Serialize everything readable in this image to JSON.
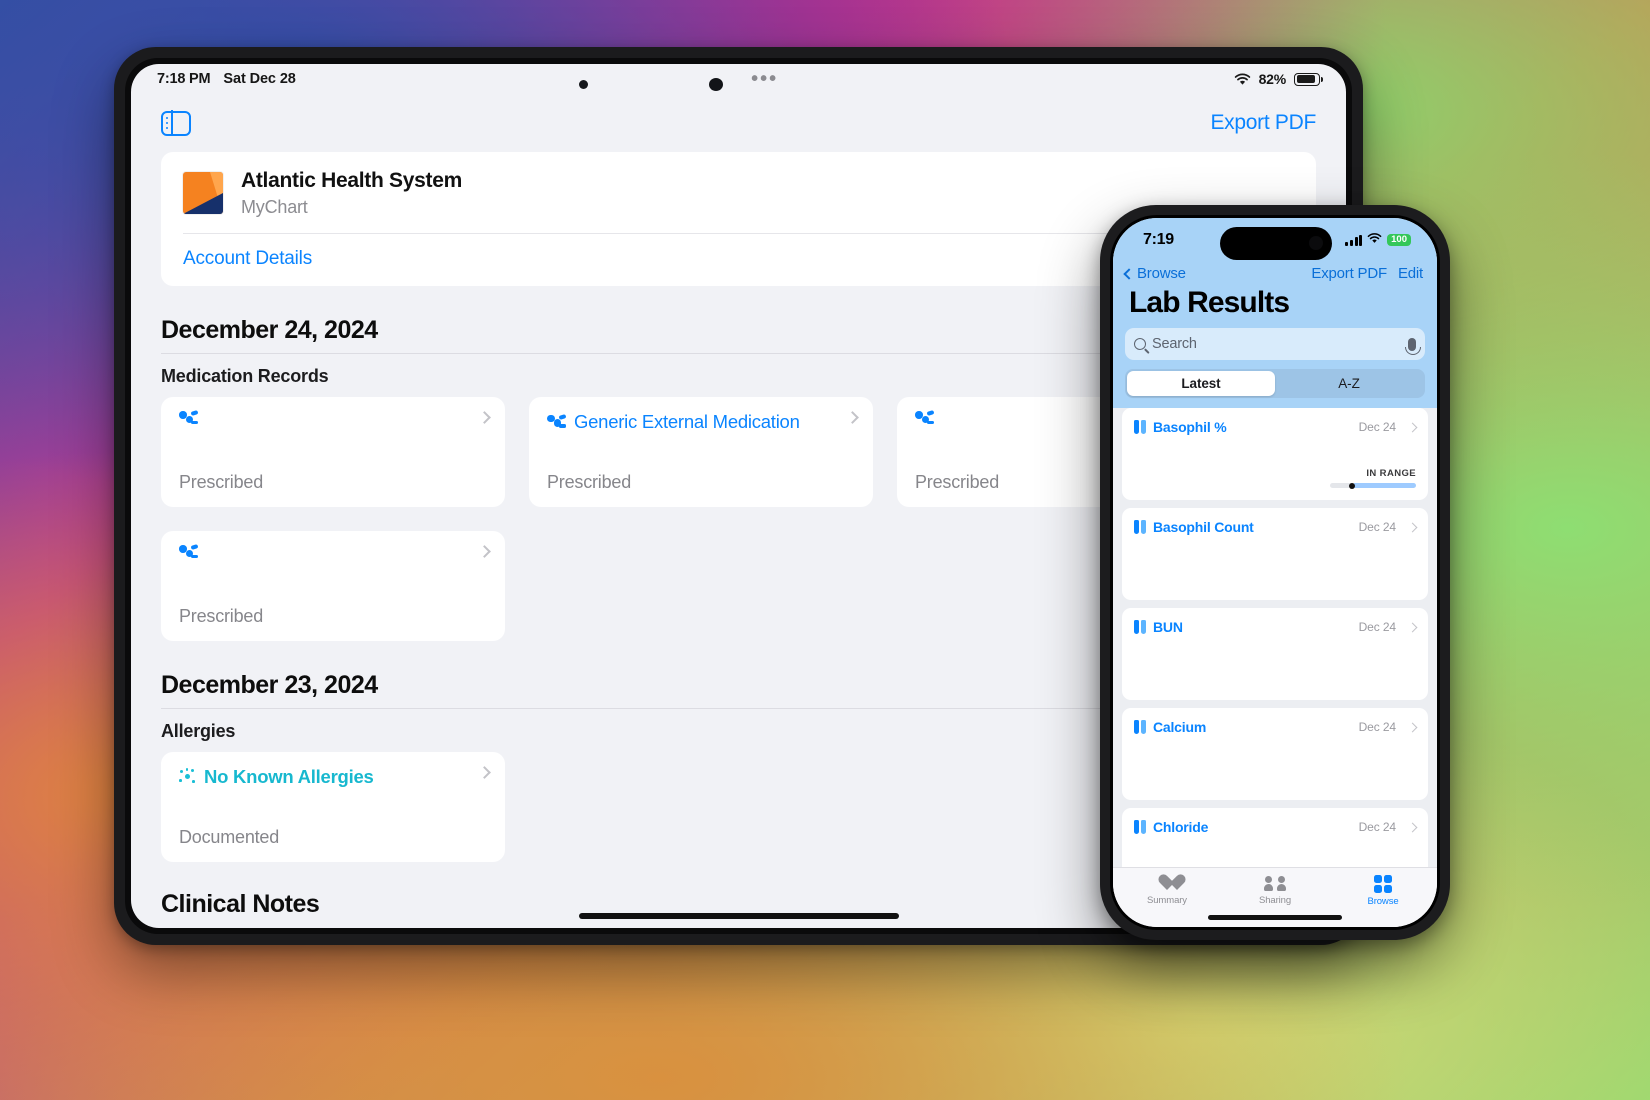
{
  "ipad": {
    "status": {
      "time": "7:18 PM",
      "date": "Sat Dec 28",
      "battery_pct": "82%"
    },
    "nav": {
      "sidebar_icon": "sidebar-toggle-icon",
      "export_pdf": "Export PDF"
    },
    "org": {
      "logo": "mychart-logo",
      "name": "Atlantic Health System",
      "subtitle": "MyChart",
      "account_details": "Account Details"
    },
    "sections": [
      {
        "date_header": "December 24, 2024",
        "title": "Medication Records",
        "cards": [
          {
            "icon": "pill-icon",
            "title": "",
            "status": "Prescribed"
          },
          {
            "icon": "pill-icon",
            "title": "Generic External Medication",
            "status": "Prescribed"
          },
          {
            "icon": "pill-icon",
            "title": "",
            "status": "Prescribed"
          }
        ],
        "cards_row2": [
          {
            "icon": "pill-icon",
            "title": "",
            "status": "Prescribed"
          }
        ]
      },
      {
        "date_header": "December 23, 2024",
        "title": "Allergies",
        "cards": [
          {
            "icon": "allergy-icon",
            "title": "No Known Allergies",
            "status": "Documented"
          }
        ],
        "next_title": "Clinical Notes"
      }
    ]
  },
  "iphone": {
    "status": {
      "time": "7:19",
      "battery_pct": "100"
    },
    "nav": {
      "back": "Browse",
      "export_pdf": "Export PDF",
      "edit": "Edit"
    },
    "title": "Lab Results",
    "search": {
      "placeholder": "Search",
      "icon": "search-icon",
      "mic_icon": "microphone-icon"
    },
    "segmented": {
      "options": [
        "Latest",
        "A-Z"
      ],
      "selected": "Latest"
    },
    "labs": [
      {
        "icon": "test-tubes-icon",
        "name": "Basophil %",
        "date": "Dec 24",
        "range_label": "IN RANGE",
        "range_pos": 26
      },
      {
        "icon": "test-tubes-icon",
        "name": "Basophil Count",
        "date": "Dec 24",
        "range_label": "",
        "range_pos": null
      },
      {
        "icon": "test-tubes-icon",
        "name": "BUN",
        "date": "Dec 24",
        "range_label": "",
        "range_pos": null
      },
      {
        "icon": "test-tubes-icon",
        "name": "Calcium",
        "date": "Dec 24",
        "range_label": "",
        "range_pos": null
      },
      {
        "icon": "test-tubes-icon",
        "name": "Chloride",
        "date": "Dec 24",
        "range_label": "",
        "range_pos": null
      }
    ],
    "tabs": [
      {
        "label": "Summary",
        "icon": "heart-icon",
        "selected": false
      },
      {
        "label": "Sharing",
        "icon": "people-icon",
        "selected": false
      },
      {
        "label": "Browse",
        "icon": "grid-icon",
        "selected": true
      }
    ]
  },
  "colors": {
    "ios_blue": "#0a84ff",
    "teal": "#17b8cf",
    "mychart_orange": "#f58220",
    "mychart_navy": "#16306b",
    "battery_green": "#34c759",
    "phone_header": "#a8d3f7"
  }
}
